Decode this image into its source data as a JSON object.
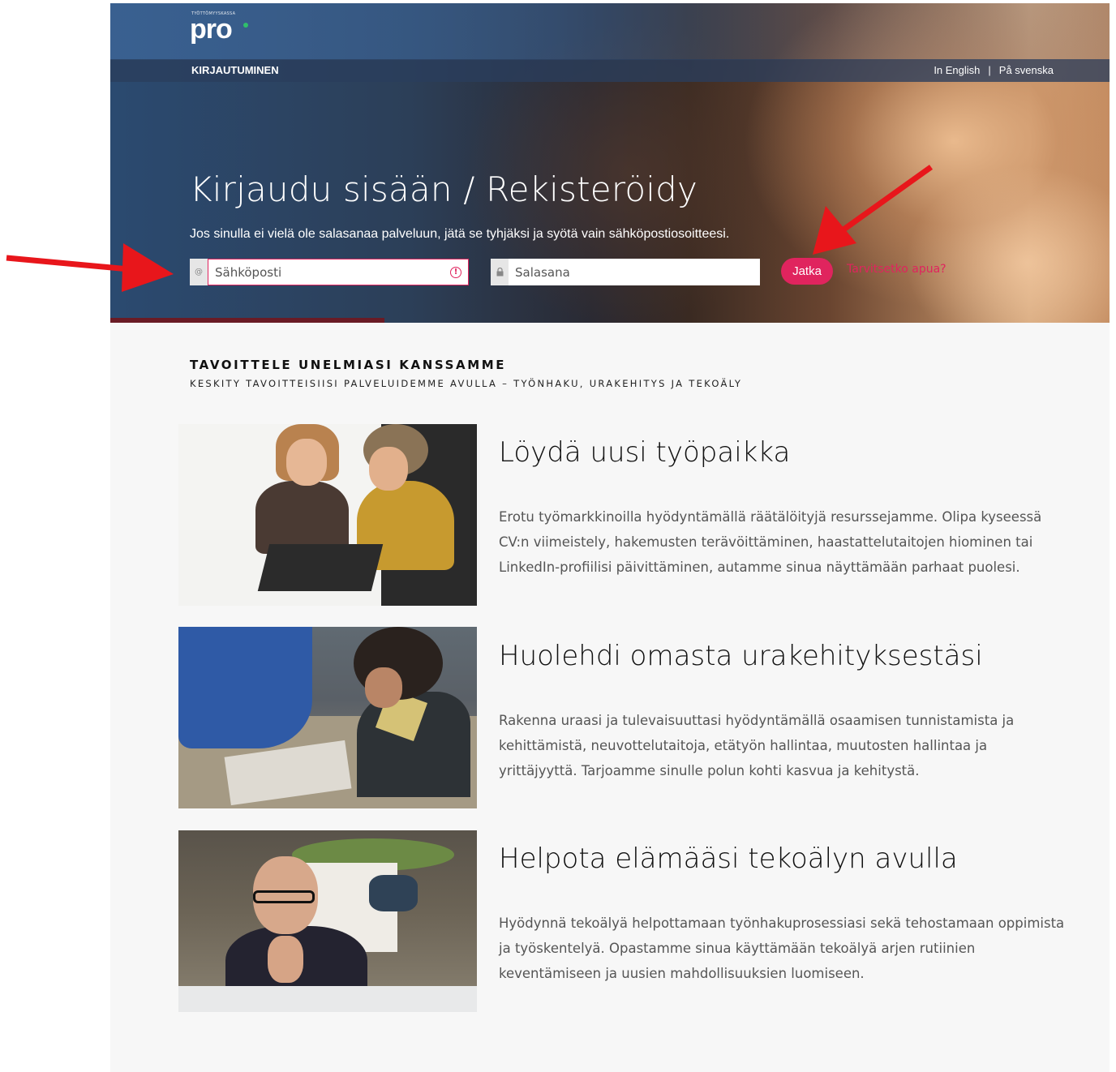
{
  "logo": {
    "small_text": "TYÖTTÖMYYSKASSA",
    "big_text": "pro",
    "accent_color": "#2fc06a"
  },
  "nav": {
    "login_label": "KIRJAUTUMINEN",
    "lang_english": "In English",
    "lang_separator": "|",
    "lang_swedish": "På svenska"
  },
  "hero": {
    "title": "Kirjaudu sisään / Rekisteröidy",
    "subtitle": "Jos sinulla ei vielä ole salasanaa palveluun, jätä se tyhjäksi ja syötä vain sähköpostiosoitteesi.",
    "email_placeholder": "Sähköposti",
    "email_icon": "at-icon",
    "email_error_icon": "error-icon",
    "password_placeholder": "Salasana",
    "password_icon": "lock-icon",
    "continue_label": "Jatka",
    "help_label": "Tarvitsetko apua?",
    "accent_color": "#e0245e"
  },
  "intro": {
    "title": "TAVOITTELE UNELMIASI KANSSAMME",
    "subtitle": "KESKITY TAVOITTEISIISI PALVELUIDEMME AVULLA – TYÖNHAKU, URAKEHITYS JA TEKOÄLY"
  },
  "features": [
    {
      "title": "Löydä uusi työpaikka",
      "text": "Erotu työmarkkinoilla hyödyntämällä räätälöityjä resurssejamme. Olipa kyseessä CV:n viimeistely, hakemusten terävöittäminen, haastattelutaitojen hiominen tai LinkedIn-profiilisi päivittäminen, autamme sinua näyttämään parhaat puolesi."
    },
    {
      "title": "Huolehdi omasta urakehityksestäsi",
      "text": "Rakenna uraasi ja tulevaisuuttasi hyödyntämällä osaamisen tunnistamista ja kehittämistä, neuvottelutaitoja, etätyön hallintaa, muutosten hallintaa ja yrittäjyyttä. Tarjoamme sinulle polun kohti kasvua ja kehitystä."
    },
    {
      "title": "Helpota elämääsi tekoälyn avulla",
      "text": "Hyödynnä tekoälyä helpottamaan työnhakuprosessiasi sekä tehostamaan oppimista ja työskentelyä. Opastamme sinua käyttämään tekoälyä arjen rutiinien keventämiseen ja uusien mahdollisuuksien luomiseen."
    }
  ],
  "annotation_color": "#e8161b"
}
